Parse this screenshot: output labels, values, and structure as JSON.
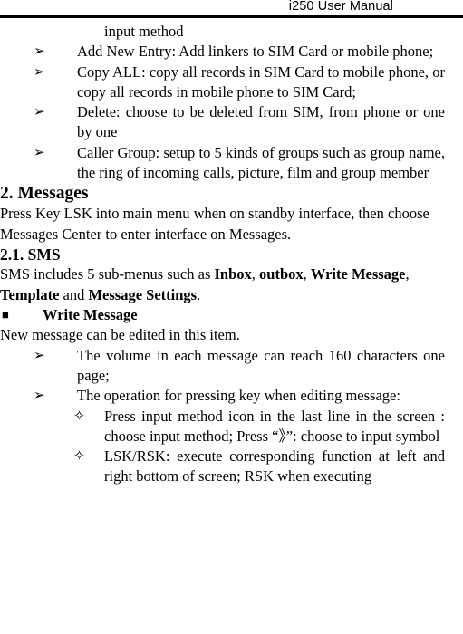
{
  "header": {
    "title": "i250 User Manual",
    "rule_color": "#000000"
  },
  "document": {
    "orphan_line": "input method",
    "bullets": {
      "arrow": "➢",
      "square": "■",
      "diamond": "✧"
    },
    "phonebook_items": [
      "Add New Entry: Add linkers to SIM Card or mobile phone;",
      "Copy ALL: copy all records in SIM Card to mobile phone, or copy all records in mobile phone to SIM Card;",
      "Delete: choose to be deleted from SIM, from phone or one by one",
      "Caller Group: setup to 5 kinds of groups such as group name, the ring of incoming calls, picture, film and group member"
    ],
    "section_messages": {
      "heading": "2. Messages",
      "intro": "Press Key LSK into main menu when on standby interface, then choose Messages Center to enter interface on Messages."
    },
    "section_sms": {
      "heading": "2.1. SMS",
      "intro_part1": "SMS includes 5 sub-menus such as ",
      "bold_inbox": "Inbox",
      "sep1": ", ",
      "bold_outbox": "outbox",
      "sep2": ", ",
      "bold_write_message": "Write Message",
      "sep3": ", ",
      "bold_template": "Template",
      "sep4": " and ",
      "bold_message_settings": "Message Settings",
      "sep5": ".",
      "write_message_heading": "Write Message",
      "write_message_intro": "New message can be edited in this item.",
      "write_message_items": [
        "The volume in each message can reach 160 characters one page;",
        "The operation for pressing key when editing message:"
      ],
      "key_operations": [
        "Press input method icon in the last line in the screen : choose input method; Press  “》”: choose to input symbol",
        "LSK/RSK: execute corresponding function at left and right bottom of screen; RSK when executing"
      ]
    }
  }
}
